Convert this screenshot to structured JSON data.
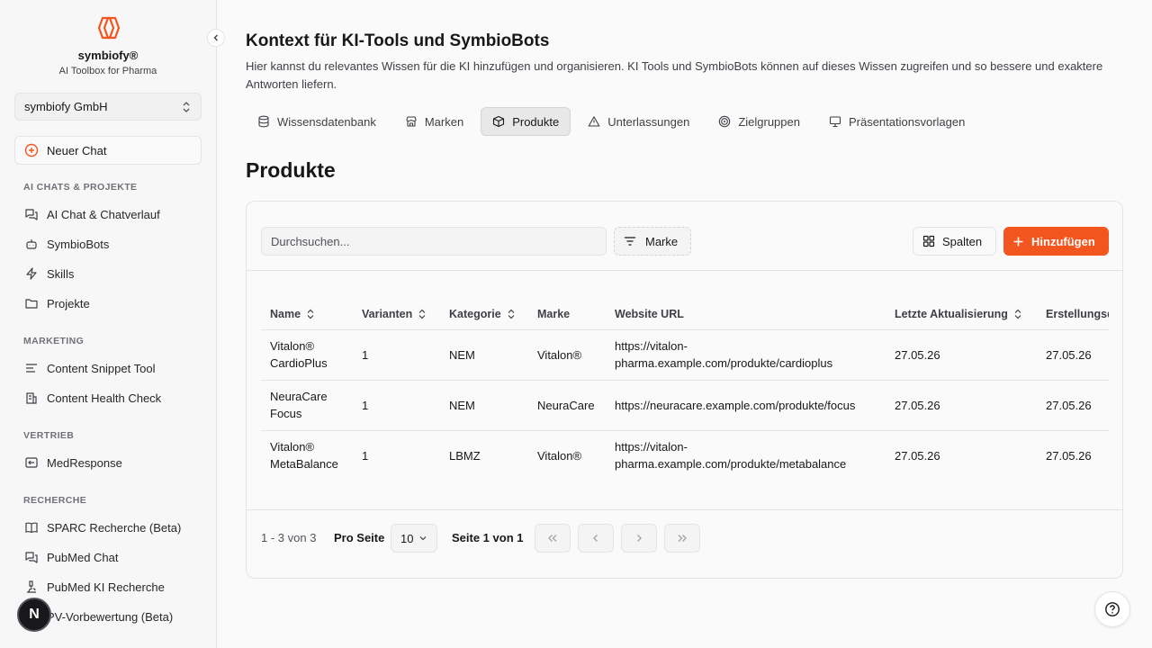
{
  "sidebar": {
    "brand_name": "symbiofy®",
    "brand_sub": "AI Toolbox for Pharma",
    "org_name": "symbiofy GmbH",
    "new_chat": "Neuer Chat",
    "sections": {
      "ai": "AI CHATS & PROJEKTE",
      "marketing": "MARKETING",
      "vertrieb": "VERTRIEB",
      "recherche": "RECHERCHE"
    },
    "items": [
      {
        "label": "AI Chat & Chatverlauf",
        "icon": "chat-icon"
      },
      {
        "label": "SymbioBots",
        "icon": "bot-icon"
      },
      {
        "label": "Skills",
        "icon": "lightning-icon"
      },
      {
        "label": "Projekte",
        "icon": "folder-icon"
      },
      {
        "label": "Content Snippet Tool",
        "icon": "text-lines-icon"
      },
      {
        "label": "Content Health Check",
        "icon": "building-check-icon"
      },
      {
        "label": "MedResponse",
        "icon": "reply-icon"
      },
      {
        "label": "SPARC Recherche (Beta)",
        "icon": "book-icon"
      },
      {
        "label": "PubMed Chat",
        "icon": "chat-icon"
      },
      {
        "label": "PubMed KI Recherche",
        "icon": "microscope-icon"
      },
      {
        "label": "PV-Vorbewertung (Beta)",
        "icon": "shield-icon"
      }
    ],
    "avatar_letter": "N"
  },
  "main": {
    "title": "Kontext für KI-Tools und SymbioBots",
    "description": "Hier kannst du relevantes Wissen für die KI hinzufügen und organisieren. KI Tools und SymbioBots können auf dieses Wissen zugreifen und so bessere und exaktere Antworten liefern.",
    "tabs": [
      {
        "label": "Wissensdatenbank",
        "icon": "database-icon"
      },
      {
        "label": "Marken",
        "icon": "store-icon"
      },
      {
        "label": "Produkte",
        "icon": "box-icon"
      },
      {
        "label": "Unterlassungen",
        "icon": "warning-icon"
      },
      {
        "label": "Zielgruppen",
        "icon": "target-icon"
      },
      {
        "label": "Präsentationsvorlagen",
        "icon": "presentation-icon"
      }
    ],
    "active_tab": "Produkte",
    "section_title": "Produkte"
  },
  "toolbar": {
    "search_placeholder": "Durchsuchen...",
    "filter_label": "Marke",
    "columns_label": "Spalten",
    "add_label": "Hinzufügen"
  },
  "table": {
    "headers": [
      "Name",
      "Varianten",
      "Kategorie",
      "Marke",
      "Website URL",
      "Letzte Aktualisierung",
      "Erstellungsdatum"
    ],
    "rows": [
      [
        "Vitalon® CardioPlus",
        "1",
        "NEM",
        "Vitalon®",
        "https://vitalon-pharma.example.com/produkte/cardioplus",
        "27.05.26",
        "27.05.26"
      ],
      [
        "NeuraCare Focus",
        "1",
        "NEM",
        "NeuraCare",
        "https://neuracare.example.com/produkte/focus",
        "27.05.26",
        "27.05.26"
      ],
      [
        "Vitalon® MetaBalance",
        "1",
        "LBMZ",
        "Vitalon®",
        "https://vitalon-pharma.example.com/produkte/metabalance",
        "27.05.26",
        "27.05.26"
      ]
    ]
  },
  "pagination": {
    "range": "1 - 3 von 3",
    "per_page_label": "Pro Seite",
    "per_page_value": "10",
    "page_of": "Seite 1 von 1"
  },
  "colors": {
    "accent": "#f2551d",
    "logo": "#f2551d"
  }
}
